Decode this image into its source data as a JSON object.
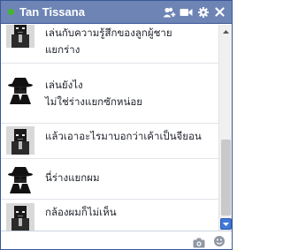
{
  "chat": {
    "contact_name": "Tan Tissana",
    "status": "online",
    "status_color": "#42b72a",
    "header_color": "#6d84b4",
    "header_icons": [
      "add-friend-icon",
      "video-call-icon",
      "gear-icon",
      "close-icon"
    ]
  },
  "messages": [
    {
      "avatar": "character-avatar",
      "lines": [
        "เล่นกับความรู้สึกของลูกผู้ชาย",
        "แยกร่าง"
      ]
    },
    {
      "avatar": "spy-avatar",
      "lines": [
        "เล่นยังไง",
        "ไม่ใช่ร่างแยกซักหน่อย"
      ]
    },
    {
      "avatar": "character-avatar",
      "lines": [
        "แล้วเอาอะไรมาบอกว่าเค้าเป็นจียอน"
      ]
    },
    {
      "avatar": "spy-avatar",
      "lines": [
        "นี่ร่างแยกผม"
      ]
    },
    {
      "avatar": "character-avatar",
      "lines": [
        "กล้องผมก็ไม่เห็น"
      ]
    }
  ],
  "composer": {
    "placeholder": "",
    "icons": [
      "camera-icon",
      "sticker-icon"
    ]
  }
}
